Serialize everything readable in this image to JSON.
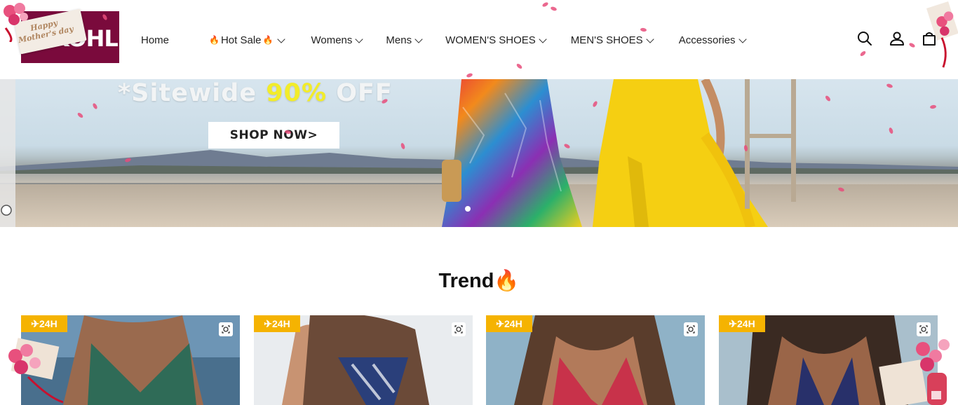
{
  "brand": {
    "name": "KOHL'S",
    "card_text": "Happy Mother's day"
  },
  "nav": {
    "items": [
      {
        "label": "Home",
        "has_menu": false
      },
      {
        "label": "Hot Sale",
        "has_menu": true,
        "flame": true
      },
      {
        "label": "Womens",
        "has_menu": true
      },
      {
        "label": "Mens",
        "has_menu": true
      },
      {
        "label": "WOMEN'S SHOES",
        "has_menu": true
      },
      {
        "label": "MEN'S SHOES",
        "has_menu": true
      },
      {
        "label": "Accessories",
        "has_menu": true
      }
    ],
    "icons": [
      "search-icon",
      "account-icon",
      "cart-icon"
    ]
  },
  "hero": {
    "title_prefix": "*Sitewide ",
    "title_highlight": "90%",
    "title_suffix": " OFF",
    "cta_label": "SHOP NOW>",
    "slide_count": 1,
    "active_slide": 1
  },
  "trend": {
    "title": "Trend",
    "products": [
      {
        "badge": "✈24H",
        "swimsuit_color": "#2f6b57"
      },
      {
        "badge": "✈24H",
        "swimsuit_color": "#2a3f7a"
      },
      {
        "badge": "✈24H",
        "swimsuit_color": "#c8324a"
      },
      {
        "badge": "✈24H",
        "swimsuit_color": "#28306a"
      }
    ]
  },
  "colors": {
    "brand": "#7a0a3c",
    "badge": "#f5b301",
    "highlight": "#f2ec2a",
    "petal": "#e84d7b"
  }
}
